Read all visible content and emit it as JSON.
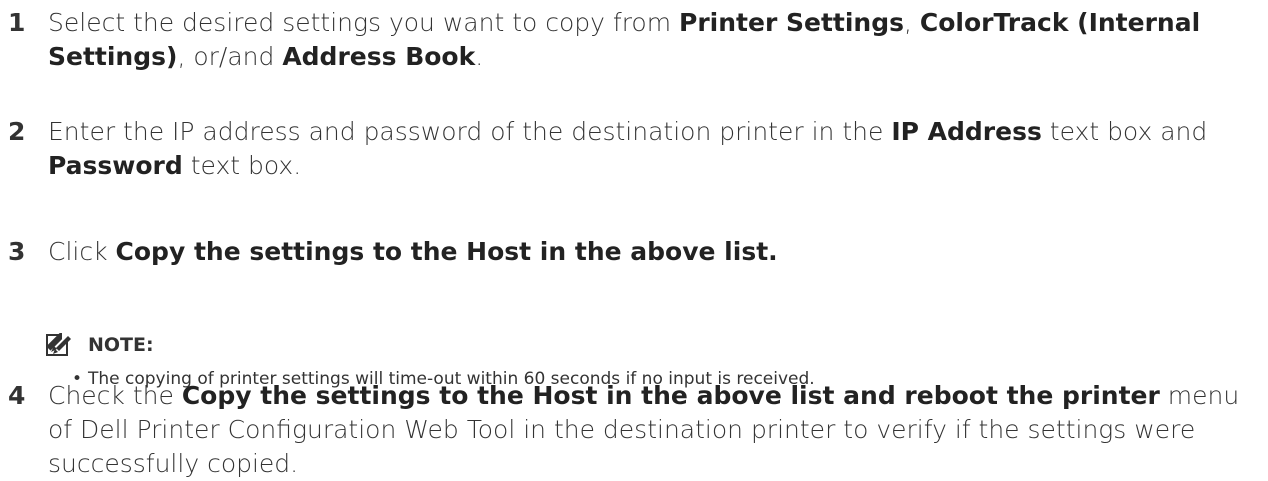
{
  "steps": [
    {
      "number": "1",
      "parts": [
        {
          "t": "Select the desired settings you want to copy from ",
          "b": false
        },
        {
          "t": "Printer Settings",
          "b": true
        },
        {
          "t": ", ",
          "b": false
        },
        {
          "t": "ColorTrack (Internal Settings)",
          "b": true
        },
        {
          "t": ", or/and ",
          "b": false
        },
        {
          "t": "Address Book",
          "b": true
        },
        {
          "t": ".",
          "b": false
        }
      ]
    },
    {
      "number": "2",
      "parts": [
        {
          "t": "Enter the IP address and password of the destination printer in the ",
          "b": false
        },
        {
          "t": "IP Address",
          "b": true
        },
        {
          "t": " text box and ",
          "b": false
        },
        {
          "t": "Password",
          "b": true
        },
        {
          "t": " text box.",
          "b": false
        }
      ]
    },
    {
      "number": "3",
      "parts": [
        {
          "t": "Click ",
          "b": false
        },
        {
          "t": "Copy the settings to the Host in the above list.",
          "b": true
        }
      ]
    },
    {
      "number": "4",
      "parts": [
        {
          "t": "Check the ",
          "b": false
        },
        {
          "t": "Copy the settings to the Host in the above list and reboot the printer",
          "b": true
        },
        {
          "t": " menu of Dell Printer Configuration Web Tool in the destination printer to verify if the settings were successfully copied.",
          "b": false
        }
      ]
    }
  ],
  "note": {
    "icon": "note-pencil-icon",
    "label": "NOTE:",
    "items": [
      "The copying of printer settings will time-out within 60 seconds if no input is received."
    ]
  }
}
